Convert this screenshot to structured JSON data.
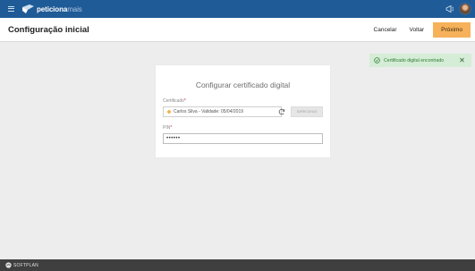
{
  "app": {
    "brand_bold": "peticiona",
    "brand_light": "mais",
    "menu_icon": "menu-icon",
    "news_icon": "megaphone-icon"
  },
  "header": {
    "title": "Configuração inicial",
    "cancel_label": "Cancelar",
    "back_label": "Voltar",
    "next_label": "Próximo"
  },
  "card": {
    "title": "Configurar certificado digital",
    "certificate": {
      "label": "Certificado",
      "required_mark": "*",
      "value": "Carlos Silva - Validade: 05/04/2019",
      "select_label": "Selecionar"
    },
    "pin": {
      "label": "PIN",
      "required_mark": "*",
      "value": "••••••"
    }
  },
  "toast": {
    "message": "Certificado digital encontrado",
    "close": "✕"
  },
  "footer": {
    "company": "SOFTPLAN"
  },
  "colors": {
    "topbar": "#1f5b96",
    "primary_button": "#f6b15a",
    "toast_bg": "#d5ecd6",
    "toast_text": "#2e7d32",
    "footer": "#3f3f3f"
  }
}
